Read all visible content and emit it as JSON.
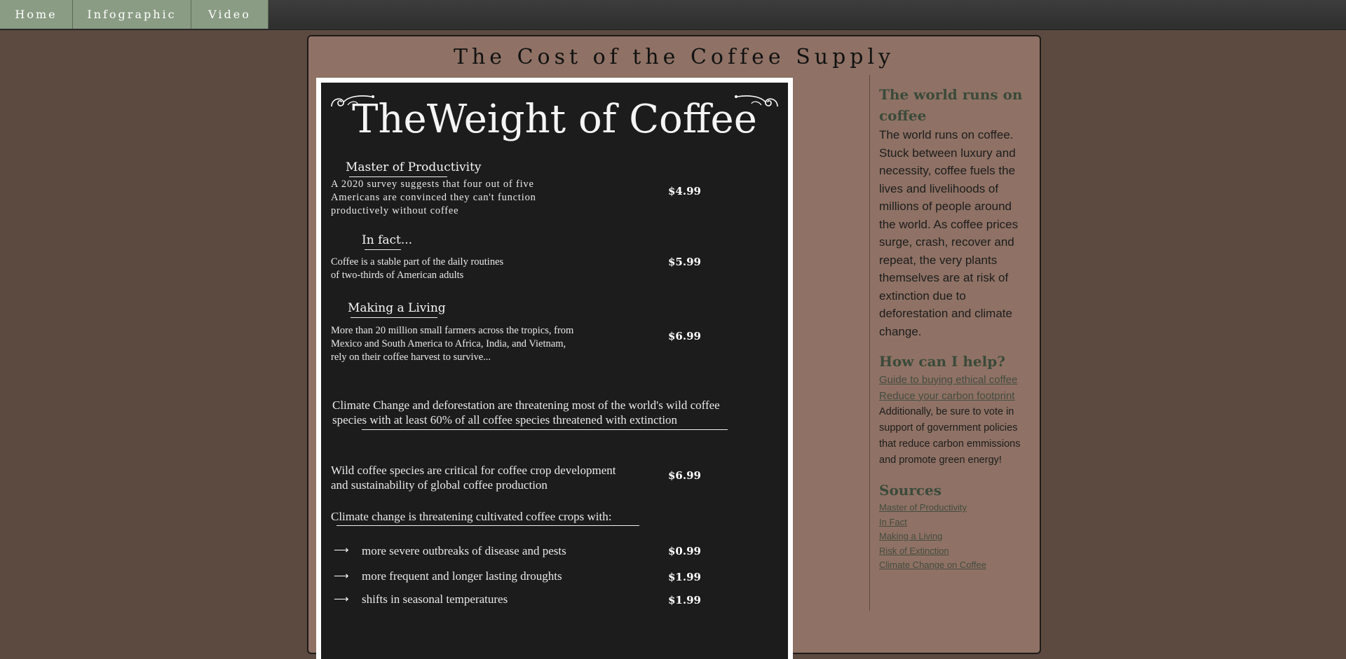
{
  "nav": {
    "items": [
      {
        "label": "Home"
      },
      {
        "label": "Infographic"
      },
      {
        "label": "Video"
      }
    ]
  },
  "page": {
    "title": "The Cost of the Coffee Supply"
  },
  "board": {
    "title": "TheWeight of Coffee",
    "sections": [
      {
        "heading": "Master of Productivity",
        "text_lines": [
          "A 2020 survey suggests that four out of five",
          "Americans are convinced they can't function",
          "productively without coffee"
        ],
        "price": "$4.99"
      },
      {
        "heading": "In fact...",
        "text_lines": [
          "Coffee is a stable part of the daily routines",
          "of two-thirds of American adults"
        ],
        "price": "$5.99"
      },
      {
        "heading": "Making a Living",
        "text_lines": [
          "More than 20 million small farmers across the tropics, from",
          "Mexico and South America to Africa, India, and Vietnam,",
          "rely on their coffee harvest to survive..."
        ],
        "price": "$6.99"
      }
    ],
    "climate_lines": [
      "Climate Change and deforestation are threatening most of the world's wild coffee",
      "species with at least 60% of all coffee species threatened with extinction"
    ],
    "wild_lines": [
      "Wild coffee species are critical for coffee crop development",
      "and sustainability of global coffee production"
    ],
    "wild_price": "$6.99",
    "threat_heading": "Climate change is threatening cultivated coffee crops with:",
    "threats": [
      {
        "text": "more severe outbreaks of disease and pests",
        "price": "$0.99"
      },
      {
        "text": "more frequent and longer lasting droughts",
        "price": "$1.99"
      },
      {
        "text": "shifts in seasonal temperatures",
        "price": "$1.99"
      }
    ]
  },
  "sidebar": {
    "world_heading": "The world runs on coffee",
    "world_text": "The world runs on coffee. Stuck between luxury and necessity, coffee fuels the lives and livelihoods of millions of people around the world. As coffee prices surge, crash, recover and repeat, the very plants themselves are at risk of extinction due to deforestation and climate change.",
    "help_heading": "How can I help?",
    "help_links": [
      "Guide to buying ethical coffee",
      "Reduce your carbon footprint"
    ],
    "help_text": "Additionally, be sure to vote in support of government policies that reduce carbon emmissions and promote green energy!",
    "sources_heading": "Sources",
    "sources": [
      "Master of Productivity",
      "In Fact",
      "Making a Living",
      "Risk of Extinction",
      "Climate Change on Coffee"
    ]
  },
  "colors": {
    "background": "#5c4a40",
    "panel": "#8f7265",
    "nav_item": "#8a9c84",
    "board": "#1c1c1c",
    "heading_green": "#3b4a3a"
  },
  "icons": [
    "arrow-right-icon",
    "swirl-ornament-icon"
  ]
}
